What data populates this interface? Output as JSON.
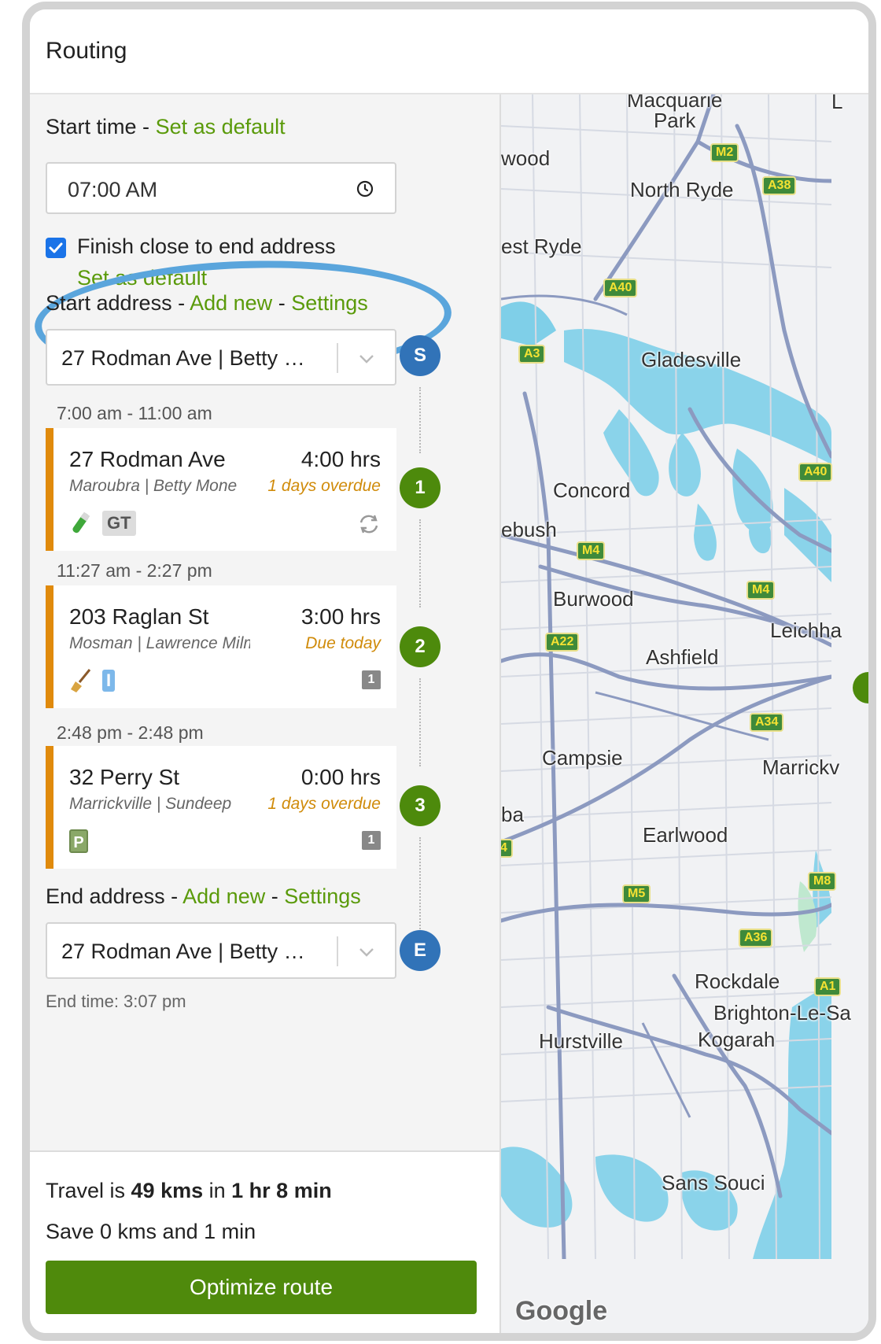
{
  "window": {
    "title": "Routing"
  },
  "start_time": {
    "label": "Start time",
    "dash": "-",
    "default_link": "Set as default",
    "value": "07:00 AM",
    "icon": "clock-icon"
  },
  "finish": {
    "checked": true,
    "label": "Finish close to end address",
    "default_link": "Set as default"
  },
  "start_address": {
    "label": "Start address",
    "dash1": "-",
    "add_new": "Add new",
    "dash2": "-",
    "settings": "Settings",
    "value": "27 Rodman Ave | Betty …",
    "pin": "S"
  },
  "stops": [
    {
      "time_range": "7:00 am - 11:00 am",
      "address": "27 Rodman Ave",
      "hours": "4:00 hrs",
      "sub": "Maroubra | Betty Mone",
      "due": "1 days overdue",
      "tag": "GT",
      "pin": "1"
    },
    {
      "time_range": "11:27 am - 2:27 pm",
      "address": "203 Raglan St",
      "hours": "3:00 hrs",
      "sub": "Mosman | Lawrence Milman",
      "due": "Due today",
      "tag": "I",
      "count": "1",
      "pin": "2"
    },
    {
      "time_range": "2:48 pm - 2:48 pm",
      "address": "32 Perry St",
      "hours": "0:00 hrs",
      "sub": "Marrickville | Sundeep",
      "due": "1 days overdue",
      "tag": "P",
      "count": "1",
      "pin": "3"
    }
  ],
  "end_address": {
    "label": "End address",
    "dash1": "-",
    "add_new": "Add new",
    "dash2": "-",
    "settings": "Settings",
    "value": "27 Rodman Ave | Betty …",
    "pin": "E",
    "end_time": "End time: 3:07 pm"
  },
  "summary": {
    "travel_prefix": "Travel is",
    "distance": "49 kms",
    "travel_in": "in",
    "duration": "1 hr 8 min",
    "save_text": "Save 0 kms and 1 min",
    "button": "Optimize route"
  },
  "map": {
    "places": [
      "Macquarie Park",
      "L",
      "wood",
      "North Ryde",
      "est Ryde",
      "Gladesville",
      "Concord",
      "ebush",
      "Burwood",
      "Leichha",
      "Ashfield",
      "Campsie",
      "Marrickv",
      "ba",
      "Earlwood",
      "Rockdale",
      "Brighton-Le-Sa",
      "Kogarah",
      "Hurstville",
      "Sans Souci"
    ],
    "shields": [
      "M2",
      "A38",
      "A40",
      "A3",
      "A40",
      "M4",
      "M4",
      "A22",
      "A34",
      "M5",
      "M8",
      "A36",
      "A1",
      "4"
    ],
    "attribution": "Google"
  }
}
